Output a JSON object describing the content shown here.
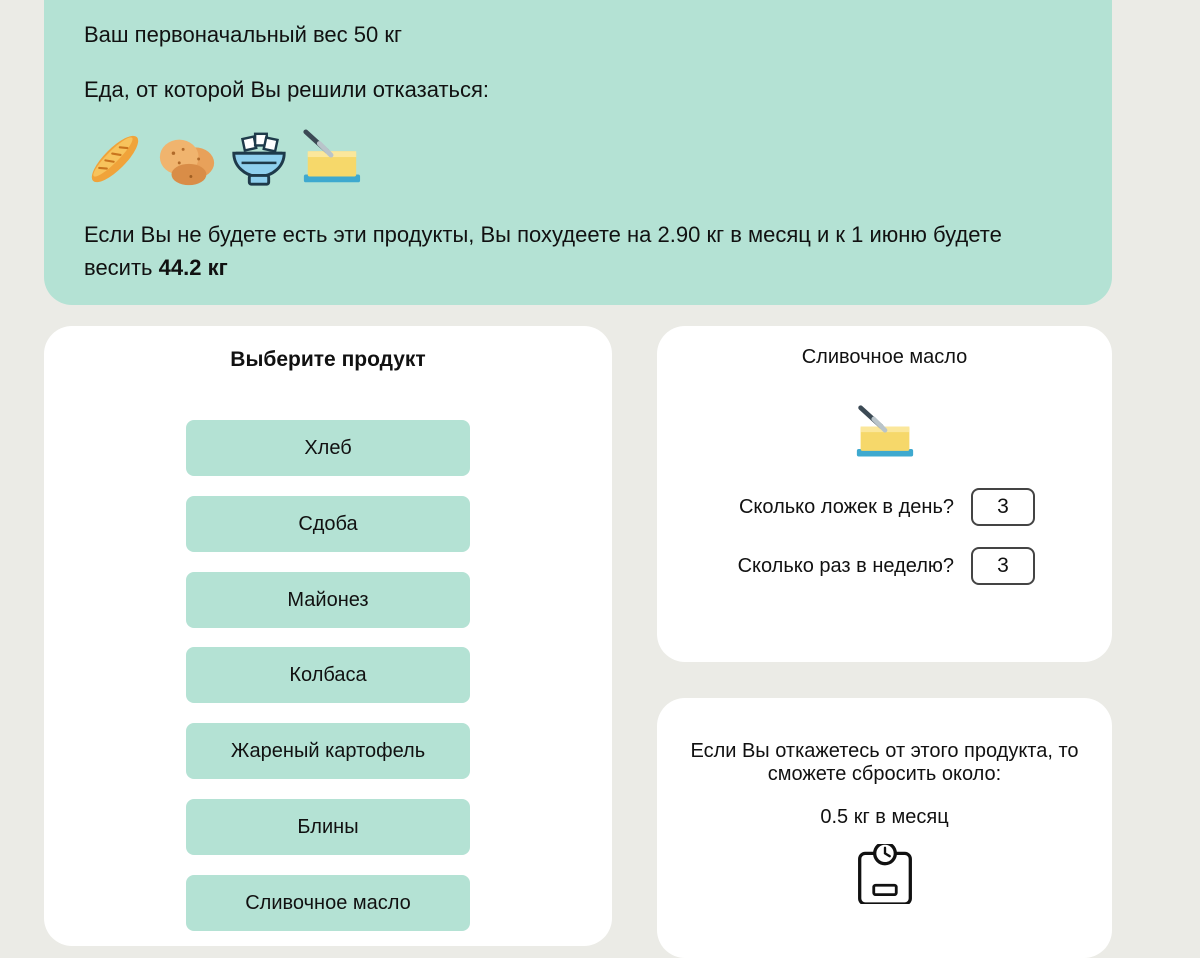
{
  "summary": {
    "initial_weight": "Ваш первоначальный вес 50 кг",
    "foods_label": "Еда, от которой Вы решили отказаться:",
    "food_icons": [
      "bread-icon",
      "potato-icon",
      "sugar-bowl-icon",
      "butter-icon"
    ],
    "result_prefix": "Если Вы не будете есть эти продукты, Вы похудеете на 2.90 кг в месяц и к 1 июню будете весить",
    "result_weight": "44.2 кг"
  },
  "chooser": {
    "title": "Выберите продукт",
    "products": [
      "Хлеб",
      "Сдоба",
      "Майонез",
      "Колбаса",
      "Жареный картофель",
      "Блины",
      "Сливочное масло"
    ]
  },
  "detail": {
    "product_name": "Сливочное масло",
    "icon": "butter-icon",
    "spoons_label": "Сколько ложек в день?",
    "spoons_value": "3",
    "times_label": "Сколько раз в неделю?",
    "times_value": "3"
  },
  "loss": {
    "text": "Если Вы откажетесь от этого продукта, то сможете сбросить около:",
    "value": "0.5 кг в месяц",
    "icon": "scale-icon"
  },
  "colors": {
    "accent": "#b4e2d4",
    "background": "#ebebe6",
    "card": "#ffffff"
  }
}
